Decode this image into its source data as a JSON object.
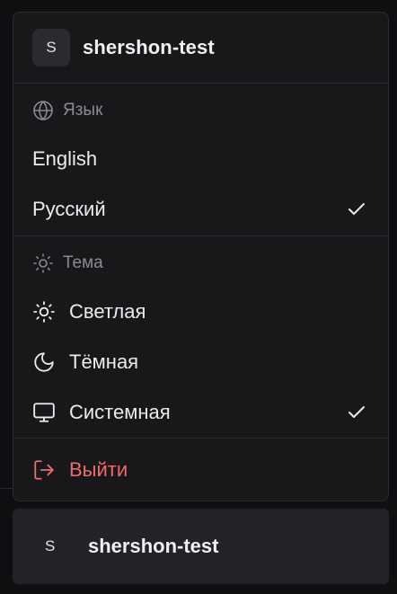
{
  "menu": {
    "header": {
      "avatar_letter": "S",
      "username": "shershon-test"
    },
    "language": {
      "label": "Язык",
      "icon": "globe-icon",
      "items": [
        {
          "label": "English",
          "selected": false
        },
        {
          "label": "Русский",
          "selected": true
        }
      ]
    },
    "theme": {
      "label": "Тема",
      "icon": "sun-icon",
      "items": [
        {
          "label": "Светлая",
          "icon": "sun-icon",
          "selected": false
        },
        {
          "label": "Тёмная",
          "icon": "moon-icon",
          "selected": false
        },
        {
          "label": "Системная",
          "icon": "monitor-icon",
          "selected": true
        }
      ]
    },
    "logout": {
      "label": "Выйти",
      "icon": "logout-icon"
    }
  },
  "user_bar": {
    "avatar_letter": "S",
    "username": "shershon-test"
  },
  "colors": {
    "background": "#0f0f12",
    "menu_bg": "#18181b",
    "border": "#2a2a30",
    "text": "#ececef",
    "muted": "#8a8a94",
    "danger": "#ef6a6a",
    "user_bar_bg": "#232327"
  }
}
